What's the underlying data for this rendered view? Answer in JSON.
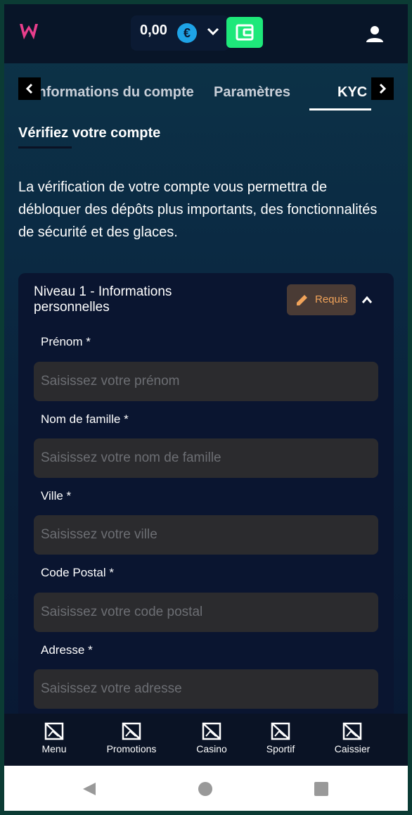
{
  "header": {
    "balance": "0,00",
    "currency_symbol": "€",
    "brand_color": "#e83e8c",
    "wallet_color": "#1ee87a"
  },
  "tabs": [
    {
      "label": "Informations du compte"
    },
    {
      "label": "Paramètres"
    },
    {
      "label": "KYC"
    }
  ],
  "section": {
    "title": "Vérifiez votre compte",
    "intro": "La vérification de votre compte vous permettra de débloquer des dépôts plus importants, des fonctionnalités de sécurité et des glaces."
  },
  "card": {
    "title": "Niveau 1 - Informations personnelles",
    "badge": "Requis",
    "badge_color": "#f0a35a",
    "fields": [
      {
        "label": "Prénom *",
        "placeholder": "Saisissez votre prénom"
      },
      {
        "label": "Nom de famille *",
        "placeholder": "Saisissez votre nom de famille"
      },
      {
        "label": "Ville *",
        "placeholder": "Saisissez votre ville"
      },
      {
        "label": "Code Postal *",
        "placeholder": "Saisissez votre code postal"
      },
      {
        "label": "Adresse *",
        "placeholder": "Saisissez votre adresse"
      }
    ]
  },
  "bottom_nav": [
    {
      "label": "Menu",
      "icon": "broken-image-icon"
    },
    {
      "label": "Promotions",
      "icon": "broken-image-icon"
    },
    {
      "label": "Casino",
      "icon": "broken-image-icon"
    },
    {
      "label": "Sportif",
      "icon": "broken-image-icon"
    },
    {
      "label": "Caissier",
      "icon": "broken-image-icon"
    }
  ]
}
